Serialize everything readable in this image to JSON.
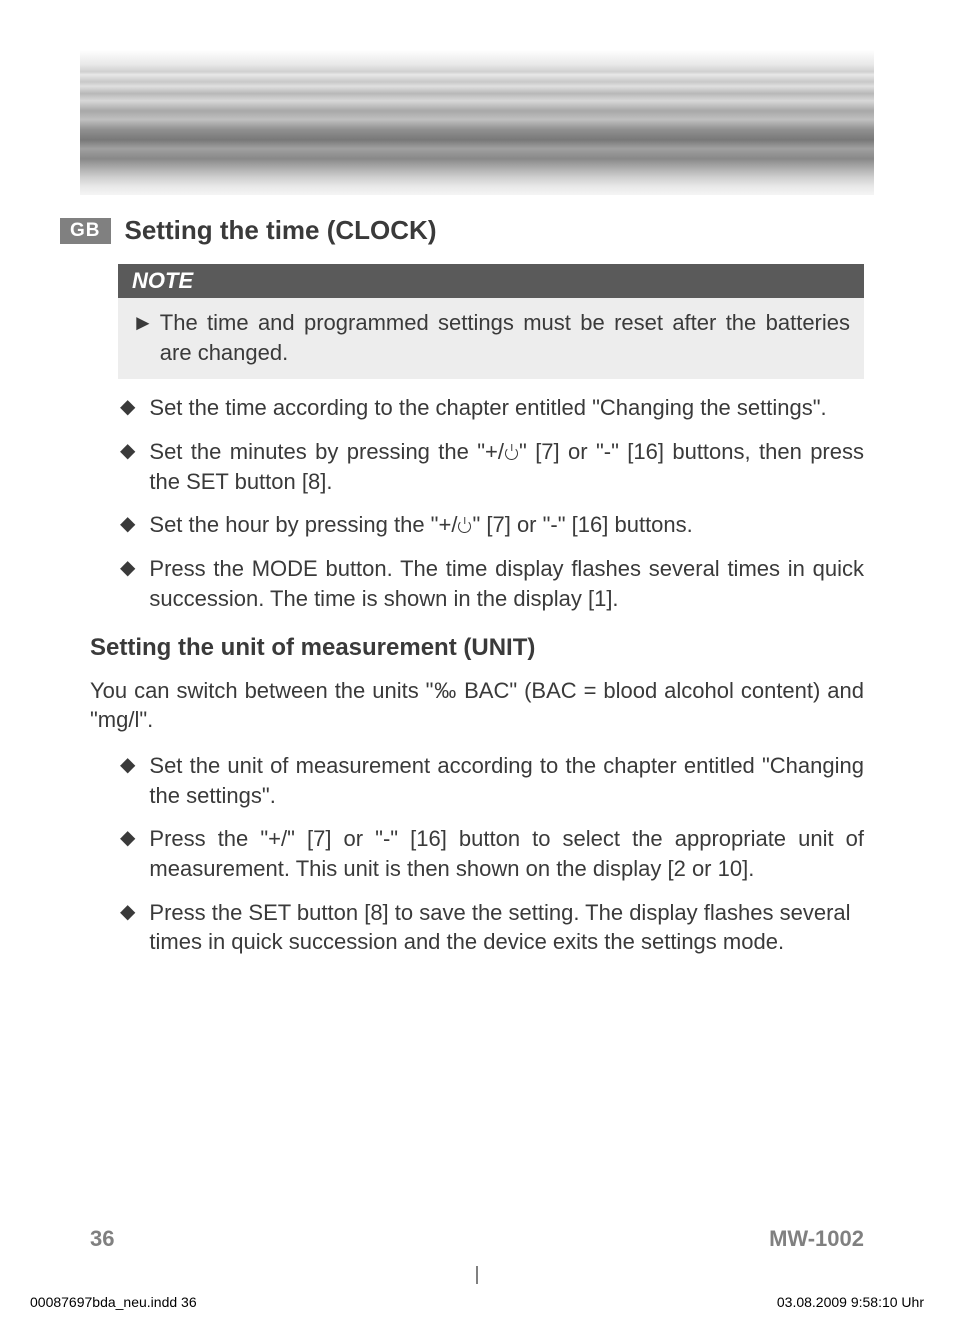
{
  "header": {
    "badge": "GB"
  },
  "section1": {
    "title": "Setting the time (CLOCK)",
    "note": {
      "label": "NOTE",
      "text": "The time and programmed settings must be reset after the batteries are changed."
    },
    "bullets": [
      "Set the time according to the chapter entitled \"Changing the settings\".",
      "Set the minutes by pressing the \"+/⏻\" [7] or \"-\" [16] buttons, then press the SET button [8].",
      "Set the hour by pressing the \"+/⏻\" [7] or \"-\" [16] buttons.",
      "Press the MODE button. The time display flashes several times in quick succession. The time is shown in the display [1]."
    ]
  },
  "section2": {
    "title": "Setting the unit of measurement (UNIT)",
    "intro": "You can switch between the units \"‰ BAC\" (BAC = blood alcohol content) and \"mg/l\".",
    "bullets": [
      "Set the unit of measurement according to the chapter entitled \"Changing the settings\".",
      "Press the \"+/\" [7] or \"-\" [16] button to select the appropriate unit of measurement. This unit is then shown on the display [2 or 10].",
      "Press the SET button [8] to save the setting. The display flashes several times in quick succession and the device exits the settings mode."
    ]
  },
  "footer": {
    "page": "36",
    "model": "MW-1002"
  },
  "meta": {
    "filename": "00087697bda_neu.indd   36",
    "timestamp": "03.08.2009   9:58:10 Uhr"
  }
}
